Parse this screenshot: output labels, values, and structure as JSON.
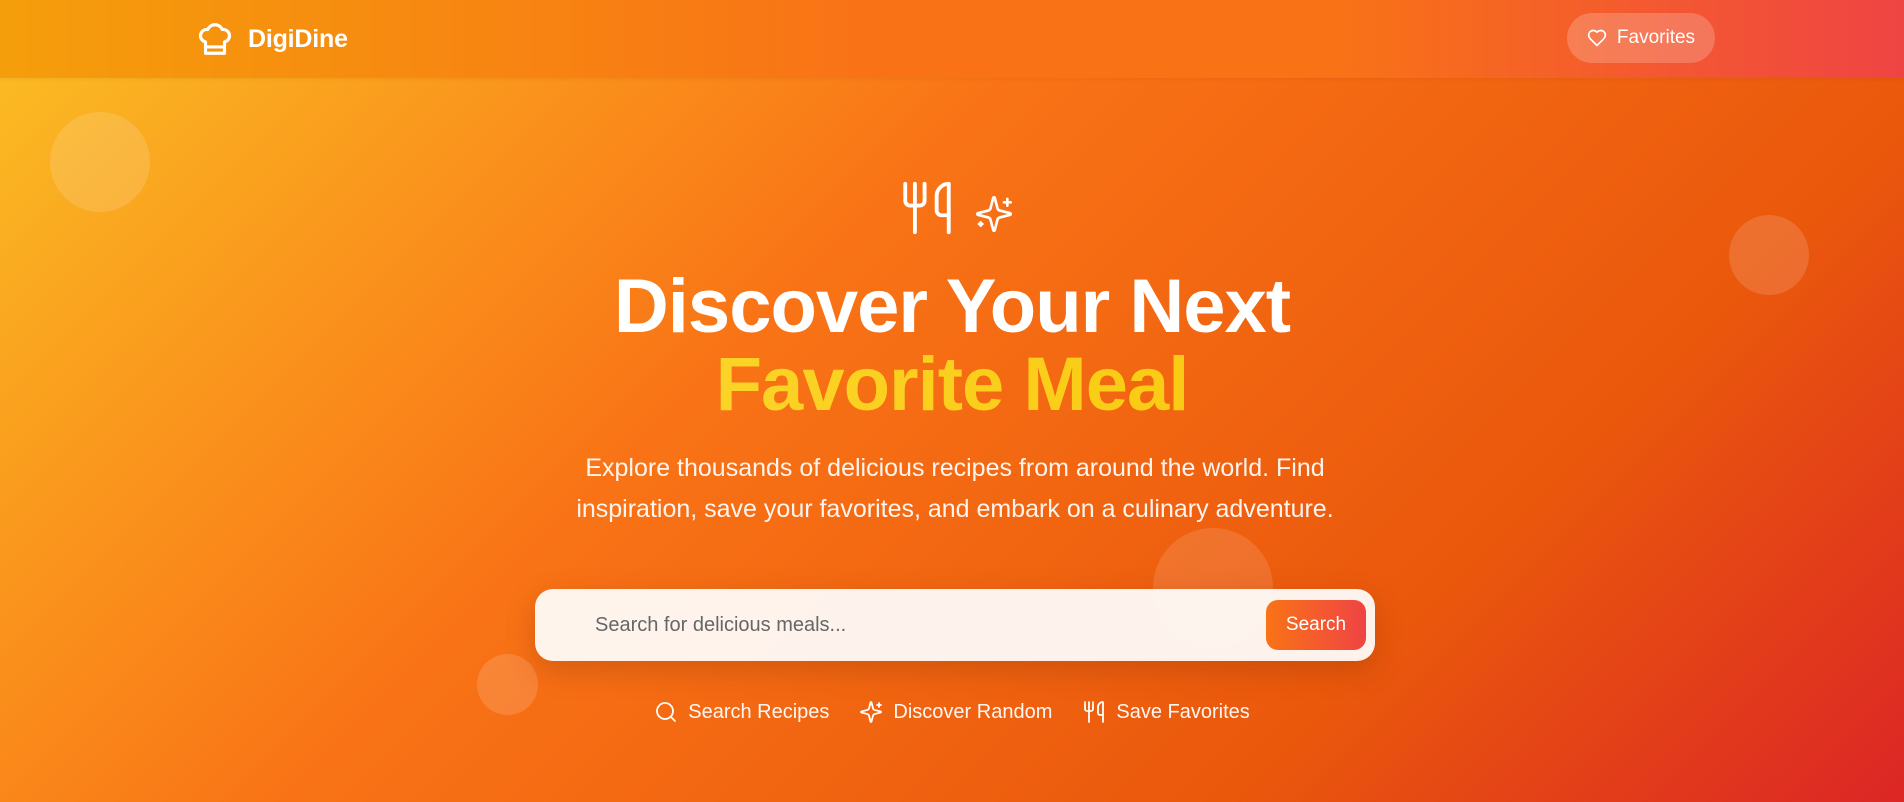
{
  "navbar": {
    "brand_name": "DigiDine",
    "brand_icon": "chef-hat-icon",
    "favorites_label": "Favorites",
    "favorites_icon": "heart-icon"
  },
  "hero": {
    "icons": [
      "utensils-icon",
      "sparkles-icon"
    ],
    "title_line1": "Discover Your Next",
    "title_line2": "Favorite Meal",
    "subtitle": "Explore thousands of delicious recipes from around the world. Find inspiration, save your favorites, and embark on a culinary adventure."
  },
  "search": {
    "placeholder": "Search for delicious meals...",
    "value": "",
    "button_label": "Search"
  },
  "features": [
    {
      "label": "Search Recipes",
      "icon": "search-icon"
    },
    {
      "label": "Discover Random",
      "icon": "sparkles-icon"
    },
    {
      "label": "Save Favorites",
      "icon": "utensils-icon"
    }
  ],
  "colors": {
    "gradient_start": "#fbbf24",
    "gradient_mid": "#f97316",
    "gradient_end": "#dc2626",
    "title_accent": "#facc15",
    "text": "#ffffff"
  }
}
